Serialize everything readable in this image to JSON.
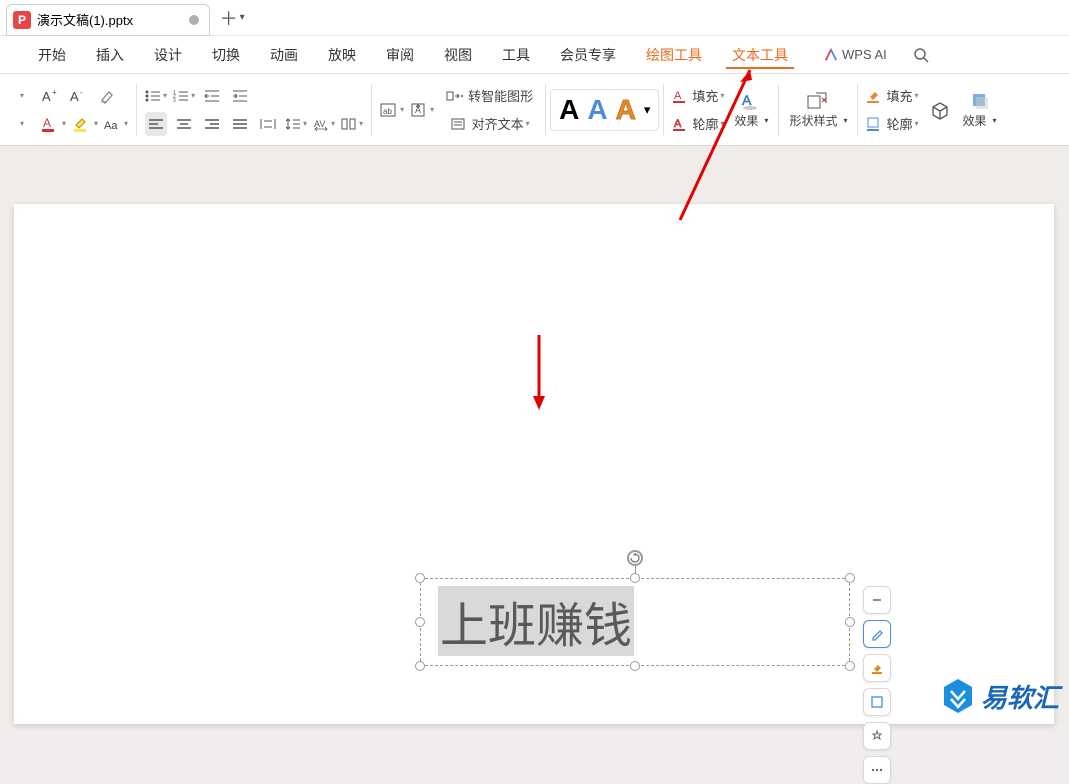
{
  "titlebar": {
    "filename": "演示文稿(1).pptx"
  },
  "menu": {
    "items": [
      "开始",
      "插入",
      "设计",
      "切换",
      "动画",
      "放映",
      "审阅",
      "视图",
      "工具",
      "会员专享"
    ],
    "draw_tools": "绘图工具",
    "text_tools": "文本工具",
    "wps_ai": "WPS AI"
  },
  "toolbar": {
    "smartshape": "转智能图形",
    "aligntext": "对齐文本",
    "fill": "填充",
    "outline": "轮廓",
    "effect": "效果",
    "shape_style": "形状样式",
    "fill2": "填充",
    "outline2": "轮廓",
    "effect2": "效果",
    "wa": "A"
  },
  "textbox": {
    "content": "上班赚钱"
  },
  "watermark": {
    "text": "易软汇"
  }
}
